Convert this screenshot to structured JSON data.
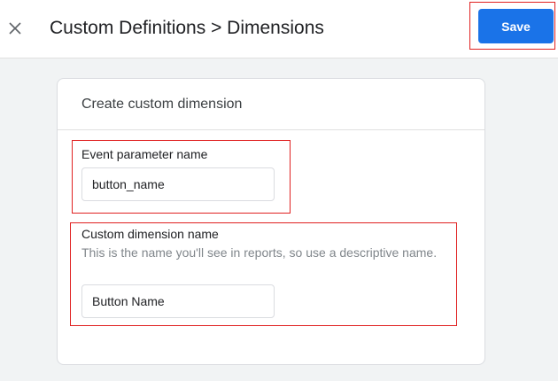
{
  "header": {
    "title": "Custom Definitions > Dimensions",
    "close_icon": "close-icon",
    "save_label": "Save",
    "accent_color": "#1a73e8",
    "highlight_color": "#e02020"
  },
  "card": {
    "title": "Create custom dimension",
    "fields": [
      {
        "label": "Event parameter name",
        "value": "button_name"
      },
      {
        "label": "Custom dimension name",
        "help_text": "This is the name you'll see in reports, so use a descriptive name.",
        "value": "Button Name"
      }
    ]
  }
}
